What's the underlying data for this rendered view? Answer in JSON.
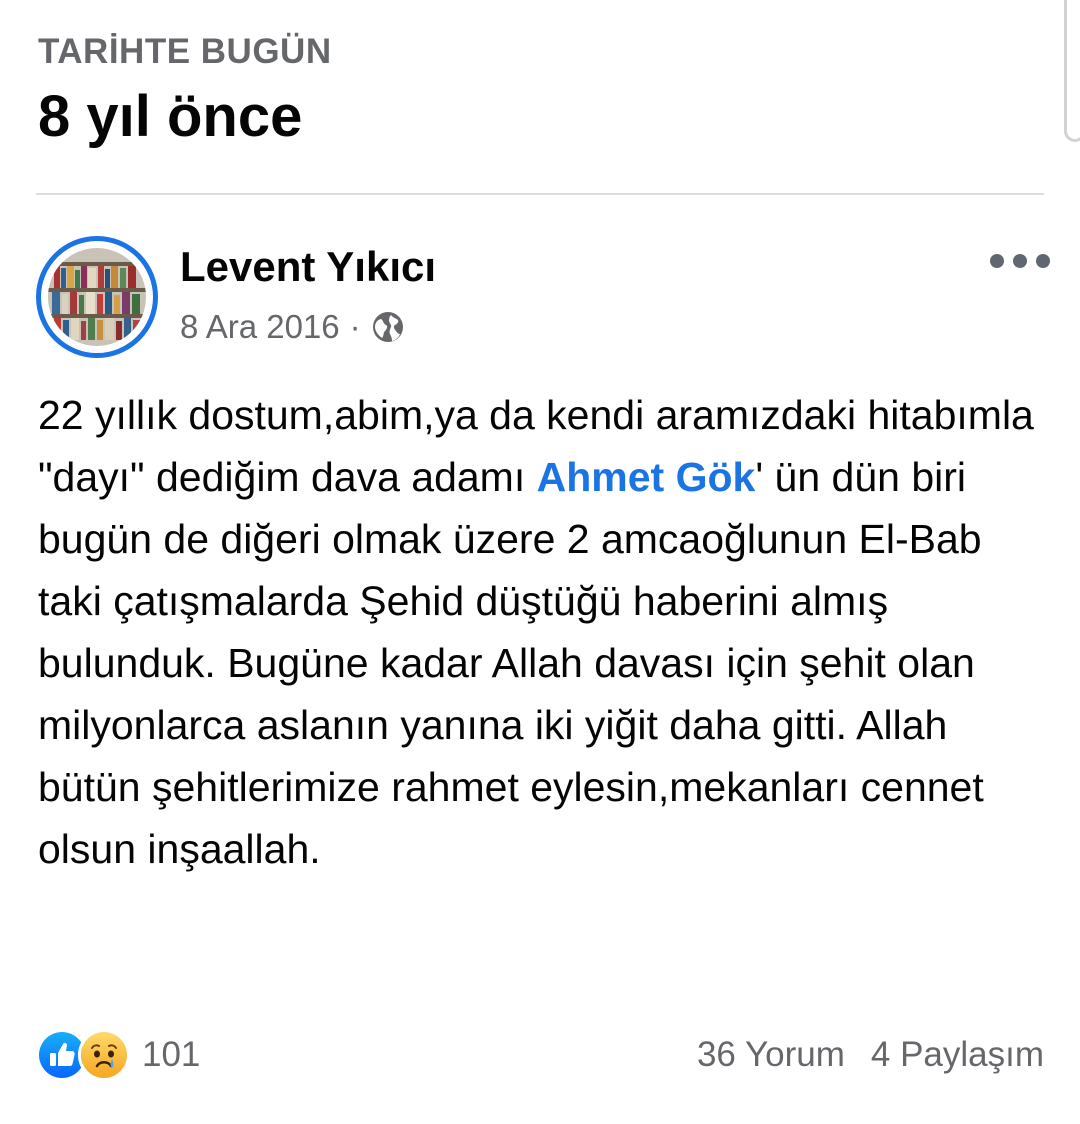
{
  "memory": {
    "label": "TARİHTE BUGÜN",
    "title": "8 yıl önce"
  },
  "post": {
    "author": "Levent Yıkıcı",
    "date": "8 Ara 2016",
    "separator": "·",
    "privacy_icon": "globe-icon",
    "more_icon": "more-horizontal-icon",
    "body": {
      "text_before_mention": "22 yıllık dostum,abim,ya da kendi aramızdaki hitabımla \"dayı\" dediğim dava adamı ",
      "mention": "Ahmet Gök",
      "text_after_mention": "' ün dün biri bugün de diğeri olmak üzere 2 amcaoğlunun El-Bab taki çatışmalarda Şehid düştüğü haberini almış bulunduk. Bugüne kadar Allah davası için şehit olan milyonlarca aslanın yanına iki yiğit daha gitti. Allah bütün şehitlerimize rahmet eylesin,mekanları cennet olsun inşaallah."
    }
  },
  "footer": {
    "reaction_icons": [
      "like-icon",
      "sad-icon"
    ],
    "reaction_count": "101",
    "comments": "36 Yorum",
    "shares": "4 Paylaşım"
  },
  "colors": {
    "accent": "#1b74e4",
    "text_primary": "#050505",
    "text_secondary": "#65676b",
    "divider": "#dadde1"
  }
}
